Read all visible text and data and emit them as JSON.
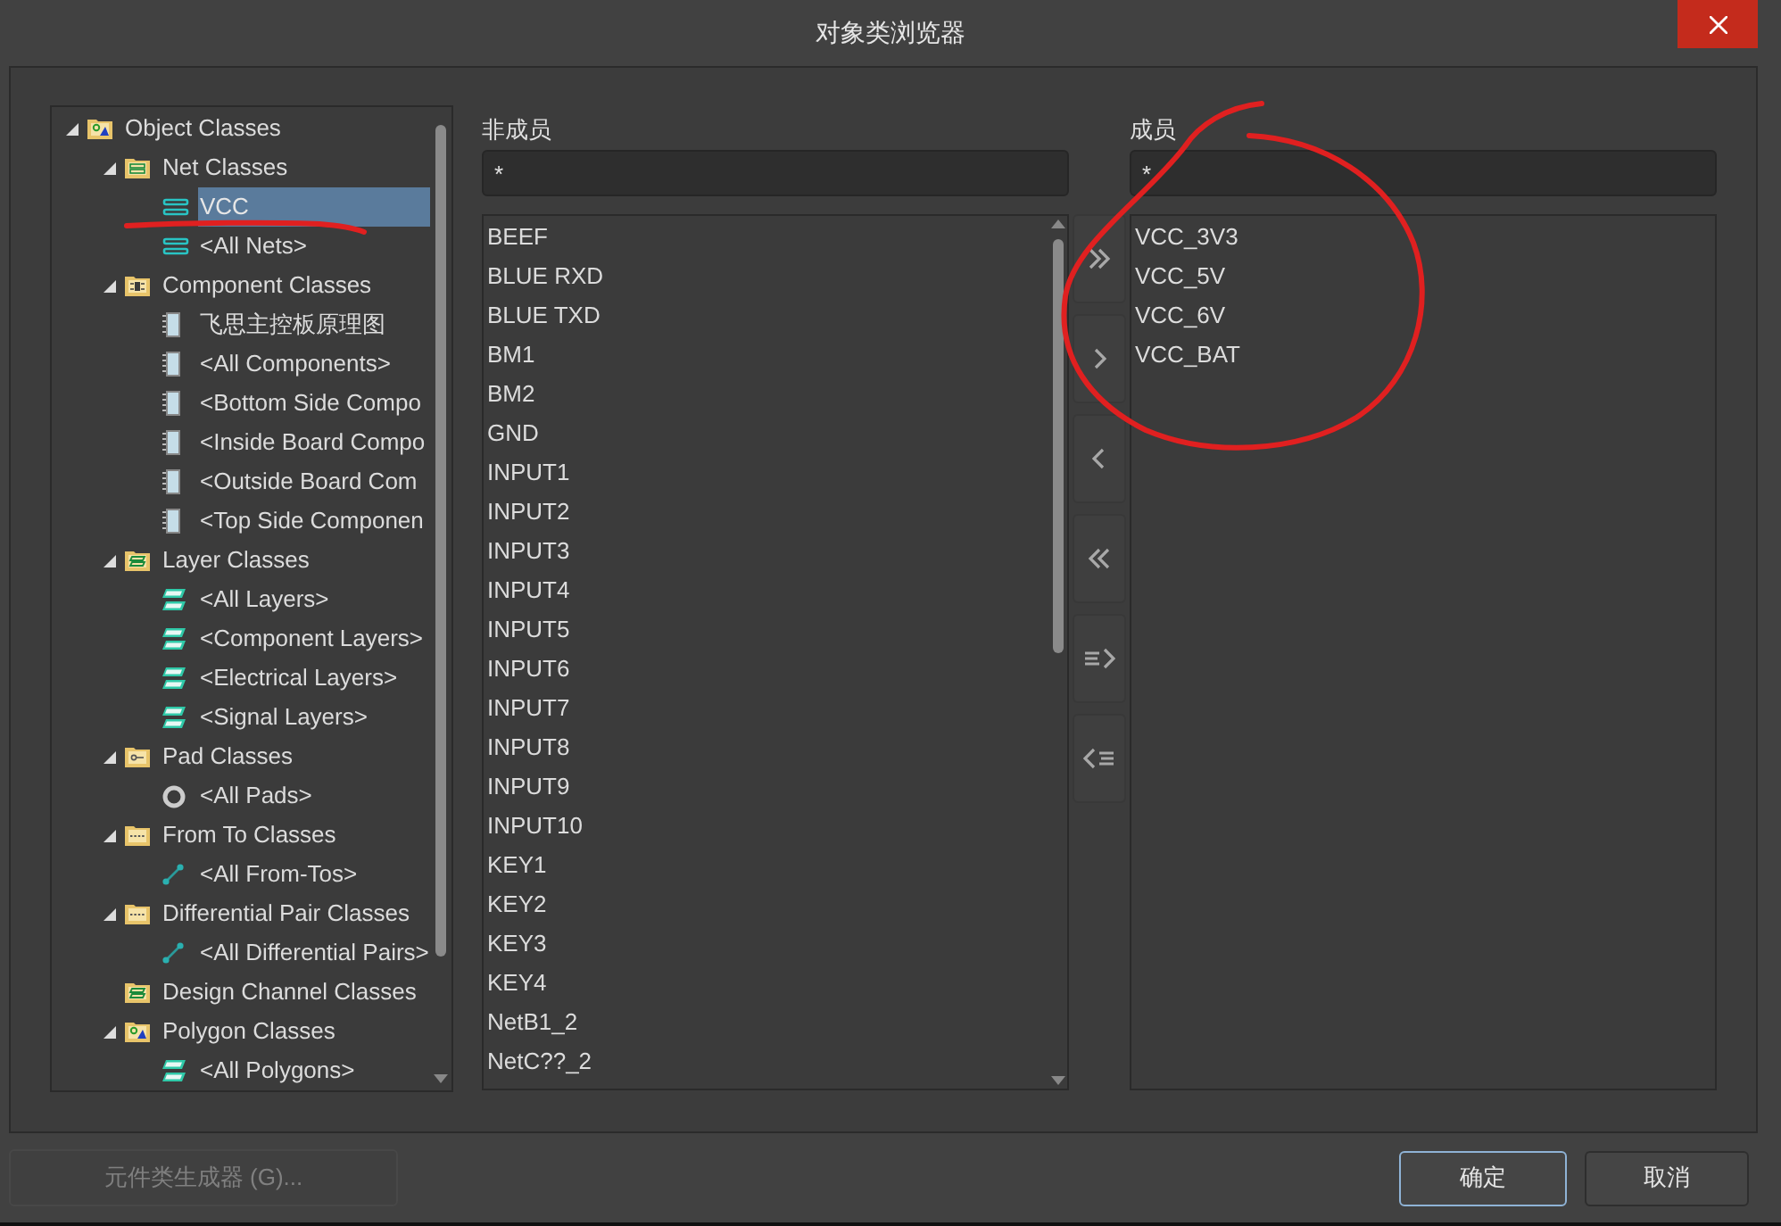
{
  "window": {
    "title": "对象类浏览器"
  },
  "tree": [
    {
      "label": "Object Classes",
      "kind": "root-folder",
      "expanded": true,
      "selected": false,
      "children": [
        {
          "label": "Net Classes",
          "kind": "net-folder",
          "expanded": true,
          "selected": false,
          "children": [
            {
              "label": "VCC",
              "kind": "net",
              "selected": true
            },
            {
              "label": "<All Nets>",
              "kind": "net",
              "selected": false
            }
          ]
        },
        {
          "label": "Component Classes",
          "kind": "component-folder",
          "expanded": true,
          "selected": false,
          "children": [
            {
              "label": "飞思主控板原理图",
              "kind": "component",
              "selected": false
            },
            {
              "label": "<All Components>",
              "kind": "component",
              "selected": false
            },
            {
              "label": "<Bottom Side Compo",
              "kind": "component",
              "selected": false
            },
            {
              "label": "<Inside Board Compo",
              "kind": "component",
              "selected": false
            },
            {
              "label": "<Outside Board Com",
              "kind": "component",
              "selected": false
            },
            {
              "label": "<Top Side Componen",
              "kind": "component",
              "selected": false
            }
          ]
        },
        {
          "label": "Layer Classes",
          "kind": "layer-folder",
          "expanded": true,
          "selected": false,
          "children": [
            {
              "label": "<All Layers>",
              "kind": "layer",
              "selected": false
            },
            {
              "label": "<Component Layers>",
              "kind": "layer",
              "selected": false
            },
            {
              "label": "<Electrical Layers>",
              "kind": "layer",
              "selected": false
            },
            {
              "label": "<Signal Layers>",
              "kind": "layer",
              "selected": false
            }
          ]
        },
        {
          "label": "Pad Classes",
          "kind": "pad-folder",
          "expanded": true,
          "selected": false,
          "children": [
            {
              "label": "<All Pads>",
              "kind": "pad",
              "selected": false
            }
          ]
        },
        {
          "label": "From To Classes",
          "kind": "fromto-folder",
          "expanded": true,
          "selected": false,
          "children": [
            {
              "label": "<All From-Tos>",
              "kind": "fromto",
              "selected": false
            }
          ]
        },
        {
          "label": "Differential Pair Classes",
          "kind": "fromto-folder",
          "expanded": true,
          "selected": false,
          "children": [
            {
              "label": "<All Differential Pairs>",
              "kind": "fromto",
              "selected": false
            }
          ]
        },
        {
          "label": "Design Channel Classes",
          "kind": "layer-folder",
          "selected": false
        },
        {
          "label": "Polygon Classes",
          "kind": "root-folder",
          "expanded": true,
          "selected": false,
          "children": [
            {
              "label": "<All Polygons>",
              "kind": "layer",
              "selected": false
            }
          ]
        }
      ]
    }
  ],
  "non_members": {
    "label": "非成员",
    "filter": "*",
    "items": [
      "BEEF",
      "BLUE RXD",
      "BLUE TXD",
      "BM1",
      "BM2",
      "GND",
      "INPUT1",
      "INPUT2",
      "INPUT3",
      "INPUT4",
      "INPUT5",
      "INPUT6",
      "INPUT7",
      "INPUT8",
      "INPUT9",
      "INPUT10",
      "KEY1",
      "KEY2",
      "KEY3",
      "KEY4",
      "NetB1_2",
      "NetC??_2"
    ]
  },
  "transfer_buttons": [
    {
      "kind": "add-all"
    },
    {
      "kind": "add"
    },
    {
      "kind": "remove"
    },
    {
      "kind": "remove-all"
    },
    {
      "kind": "add-selected"
    },
    {
      "kind": "remove-selected"
    }
  ],
  "members": {
    "label": "成员",
    "filter": "*",
    "items": [
      "VCC_3V3",
      "VCC_5V",
      "VCC_6V",
      "VCC_BAT"
    ]
  },
  "footer": {
    "generator_button": {
      "label": "元件类生成器 (G)...",
      "disabled": true
    },
    "ok_button": {
      "label": "确定",
      "focused": true
    },
    "cancel_button": {
      "label": "取消"
    }
  }
}
